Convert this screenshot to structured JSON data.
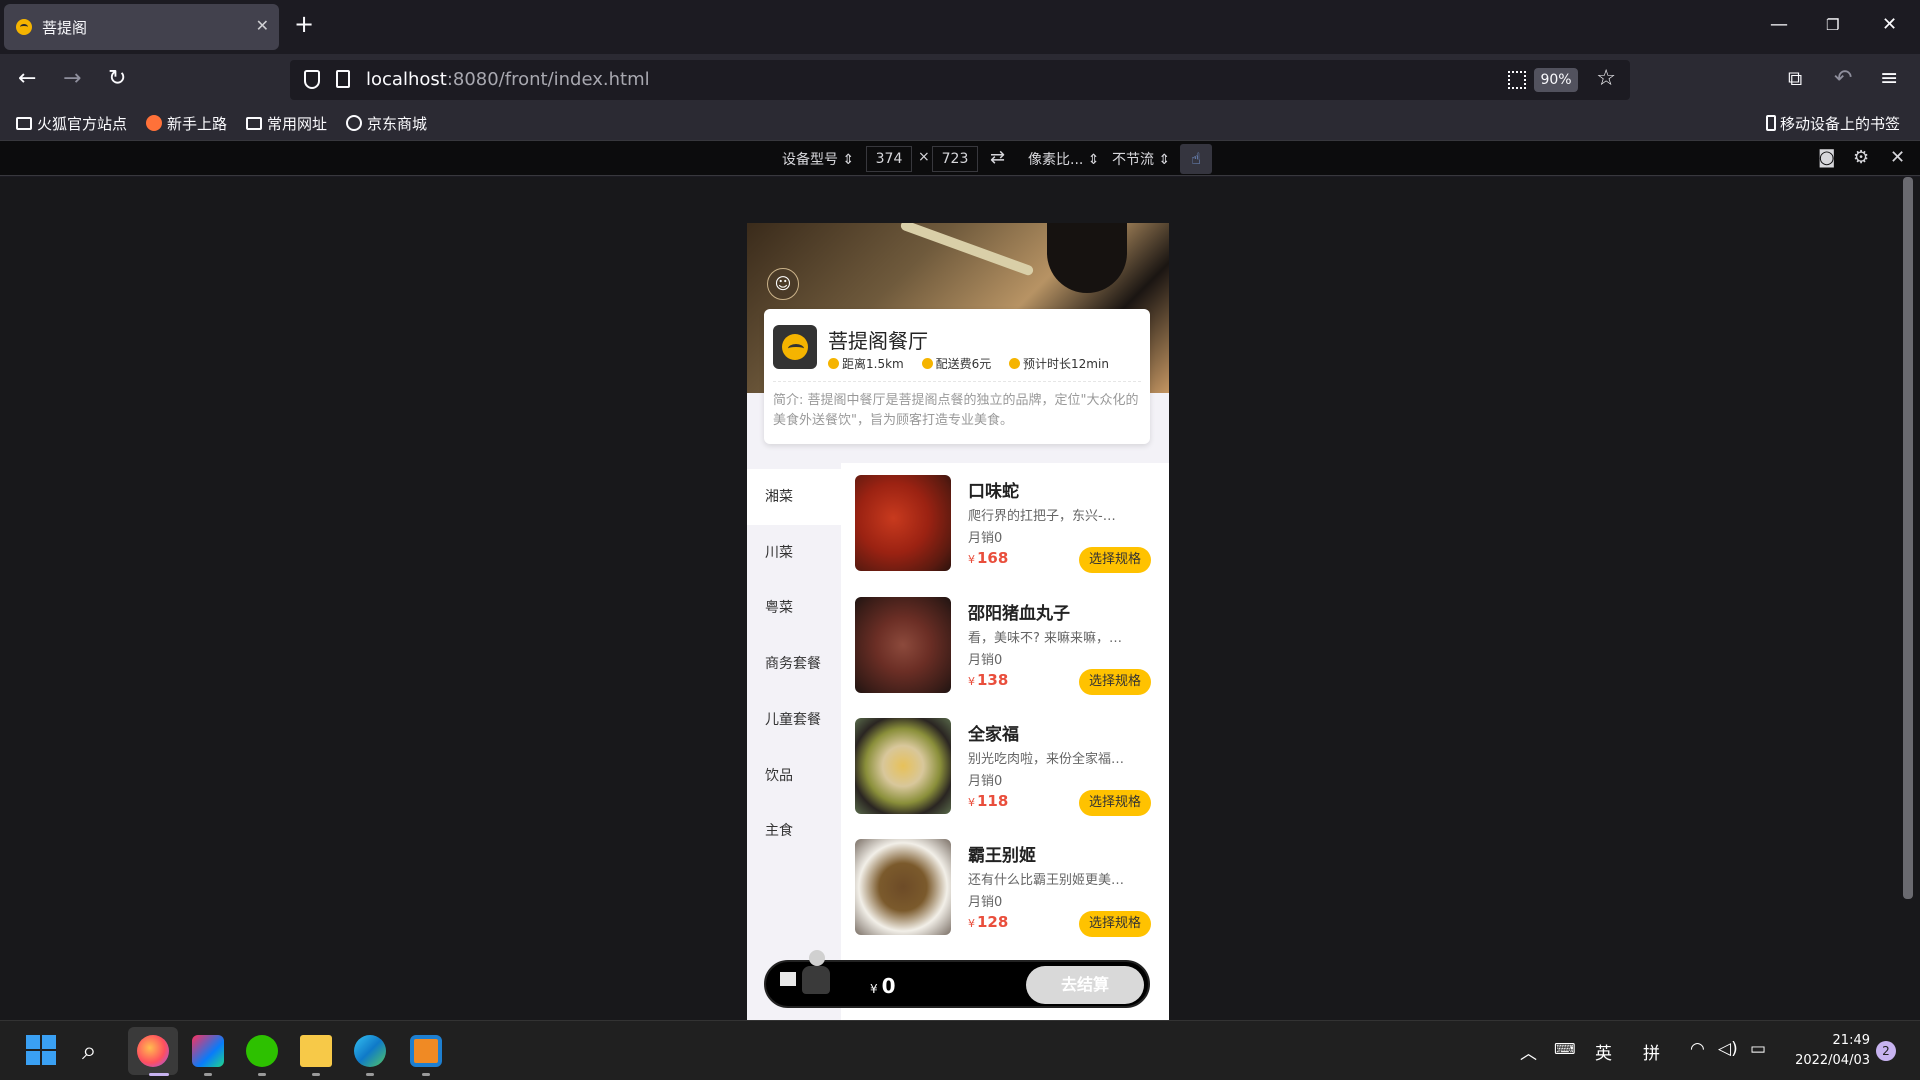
{
  "browser": {
    "tab_title": "菩提阁",
    "url_host": "localhost",
    "url_rest": ":8080/front/index.html",
    "zoom": "90%",
    "bookmarks": [
      "火狐官方站点",
      "新手上路",
      "常用网址",
      "京东商城"
    ],
    "mobile_bookmarks": "移动设备上的书签"
  },
  "rdm": {
    "device_label": "设备型号",
    "width": "374",
    "times": "×",
    "height": "723",
    "dpr_label": "像素比...",
    "throttle_label": "不节流"
  },
  "shop": {
    "name": "菩提阁餐厅",
    "distance": "距离1.5km",
    "delivery_fee": "配送费6元",
    "eta": "预计时长12min",
    "description": "简介: 菩提阁中餐厅是菩提阁点餐的独立的品牌，定位\"大众化的美食外送餐饮\"，旨为顾客打造专业美食。"
  },
  "categories": [
    {
      "label": "湘菜"
    },
    {
      "label": "川菜"
    },
    {
      "label": "粤菜"
    },
    {
      "label": "商务套餐"
    },
    {
      "label": "儿童套餐"
    },
    {
      "label": "饮品"
    },
    {
      "label": "主食"
    }
  ],
  "dishes": [
    {
      "name": "口味蛇",
      "desc": "爬行界的扛把子，东兴-…",
      "sales": "月销0",
      "currency": "¥",
      "price": "168",
      "button": "选择规格"
    },
    {
      "name": "邵阳猪血丸子",
      "desc": "看，美味不? 来嘛来嘛，…",
      "sales": "月销0",
      "currency": "¥",
      "price": "138",
      "button": "选择规格"
    },
    {
      "name": "全家福",
      "desc": "别光吃肉啦，来份全家福…",
      "sales": "月销0",
      "currency": "¥",
      "price": "118",
      "button": "选择规格"
    },
    {
      "name": "霸王别姬",
      "desc": "还有什么比霸王别姬更美…",
      "sales": "月销0",
      "currency": "¥",
      "price": "128",
      "button": "选择规格"
    }
  ],
  "cart": {
    "currency": "¥",
    "total": "0",
    "checkout": "去结算"
  },
  "taskbar": {
    "ime_lang": "英",
    "ime_mode": "拼",
    "time": "21:49",
    "date": "2022/04/03",
    "notifications": "2"
  }
}
